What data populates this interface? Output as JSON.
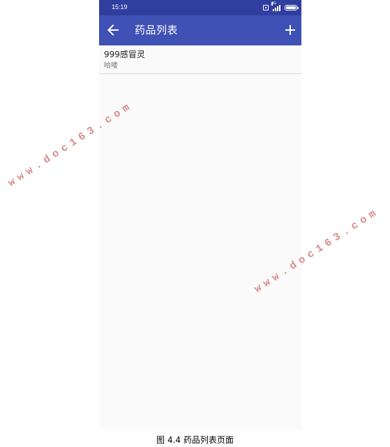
{
  "status_bar": {
    "time": "15:19",
    "signal_tag": "4G",
    "icons": [
      "sim-icon",
      "signal-icon",
      "battery-icon"
    ]
  },
  "app_bar": {
    "title": "药品列表",
    "back_icon": "arrow-left-icon",
    "add_icon": "plus-icon",
    "background": "#3f51b5",
    "status_background": "#303f9f"
  },
  "medicines": [
    {
      "name": "999感冒灵",
      "note": "哈喽"
    }
  ],
  "watermarks": [
    "www.doc163.com",
    "www.doc163.com"
  ],
  "caption": "图 4.4 药品列表页面"
}
